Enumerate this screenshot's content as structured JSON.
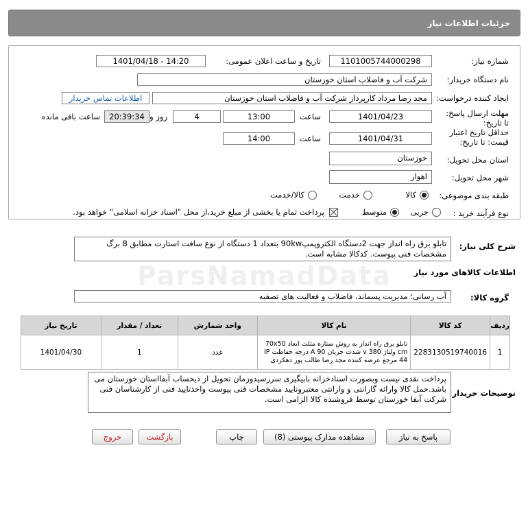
{
  "header": {
    "title": "جزئیات اطلاعات نیاز"
  },
  "form": {
    "need_number_label": "شماره نیاز:",
    "need_number": "1101005744000298",
    "announce_label": "تاریخ و ساعت اعلان عمومی:",
    "announce_value": "1401/04/18 - 14:20",
    "buyer_org_label": "نام دستگاه خریدار:",
    "buyer_org": "شرکت آب و فاضلاب استان خوزستان",
    "creator_label": "ایجاد کننده درخواست:",
    "creator": "مجد رضا مرداد کارپرداز شرکت آب و فاضلاب استان خوزستان",
    "contact_link": "اطلاعات تماس خریدار",
    "deadline_label": "مهلت ارسال پاسخ: تا تاریخ:",
    "deadline_date": "1401/04/23",
    "time_label": "ساعت",
    "deadline_time": "13:00",
    "days_value": "4",
    "days_label": "روز و",
    "remaining_time": "20:39:34",
    "remaining_label": "ساعت باقی مانده",
    "validity_label": "حداقل تاریخ اعتبار قیمت: تا تاریخ:",
    "validity_date": "1401/04/31",
    "validity_time": "14:00",
    "province_label": "استان محل تحویل:",
    "province": "خوزستان",
    "city_label": "شهر محل تحویل:",
    "city": "اهواز",
    "category_label": "طبقه بندی موضوعی:",
    "category_options": [
      "کالا",
      "خدمت",
      "کالا/خدمت"
    ],
    "category_selected": "کالا",
    "process_label": "نوع فرآیند خرید :",
    "process_options": [
      "جزیی",
      "متوسط"
    ],
    "process_selected": "متوسط",
    "payment_note": "پرداخت تمام یا بخشی از مبلغ خرید،از محل \"اسناد خزانه اسلامی\" خواهد بود."
  },
  "description": {
    "label": "شرح کلی نیاز:",
    "text": "تابلو برق راه انداز جهت 2دستگاه الکتروپمپ90kw بتعداد 1 دستگاه از نوع سافت استارت مطابق 8 برگ مشخصات فنی پیوست. کدکالا مشابه است."
  },
  "goods_section": {
    "title": "اطلاعات کالاهای مورد نیاز",
    "group_label": "گروه کالا:",
    "group_value": "آب رسانی؛ مدیریت پسماند، فاضلاب و فعالیت های تصفیه"
  },
  "table": {
    "headers": [
      "ردیف",
      "کد کالا",
      "نام کالا",
      "واحد شمارش",
      "تعداد / مقدار",
      "تاریخ نیاز"
    ],
    "rows": [
      {
        "index": "1",
        "code": "2283130519740016",
        "name": "تابلو برق راه انداز به روش ستاره مثلث ابعاد 70x50 cm ولتاژ 380 v شدت جریان 90 A درجه حفاظت IP 44 مرجع عرضه کننده مجد رضا طالب پور دهکردی",
        "unit": "عدد",
        "qty": "1",
        "date": "1401/04/30"
      }
    ]
  },
  "buyer_notes": {
    "label": "توضیحات خریدار:",
    "text": "پرداخت نقدی نیست وبصورت اسنادخزانه بابیگیری سررسیدوزمان تحویل از ذیحساب آبفااستان خوزستان می باشد.حمل کالا وارائه گارانتی و وارانتی معتبروتایید مشخصات فنی پیوست واخذتایید فنی از کارشناسان فنی شرکت آبفا خوزستان توسط فروشنده کالا الزامی است."
  },
  "buttons": {
    "reply": "پاسخ به نیاز",
    "attachments": "مشاهده مدارک پیوستی (8)",
    "print": "چاپ",
    "back": "بازگشت",
    "exit": "خروج"
  },
  "watermark": {
    "text": "ParsNamadData"
  }
}
